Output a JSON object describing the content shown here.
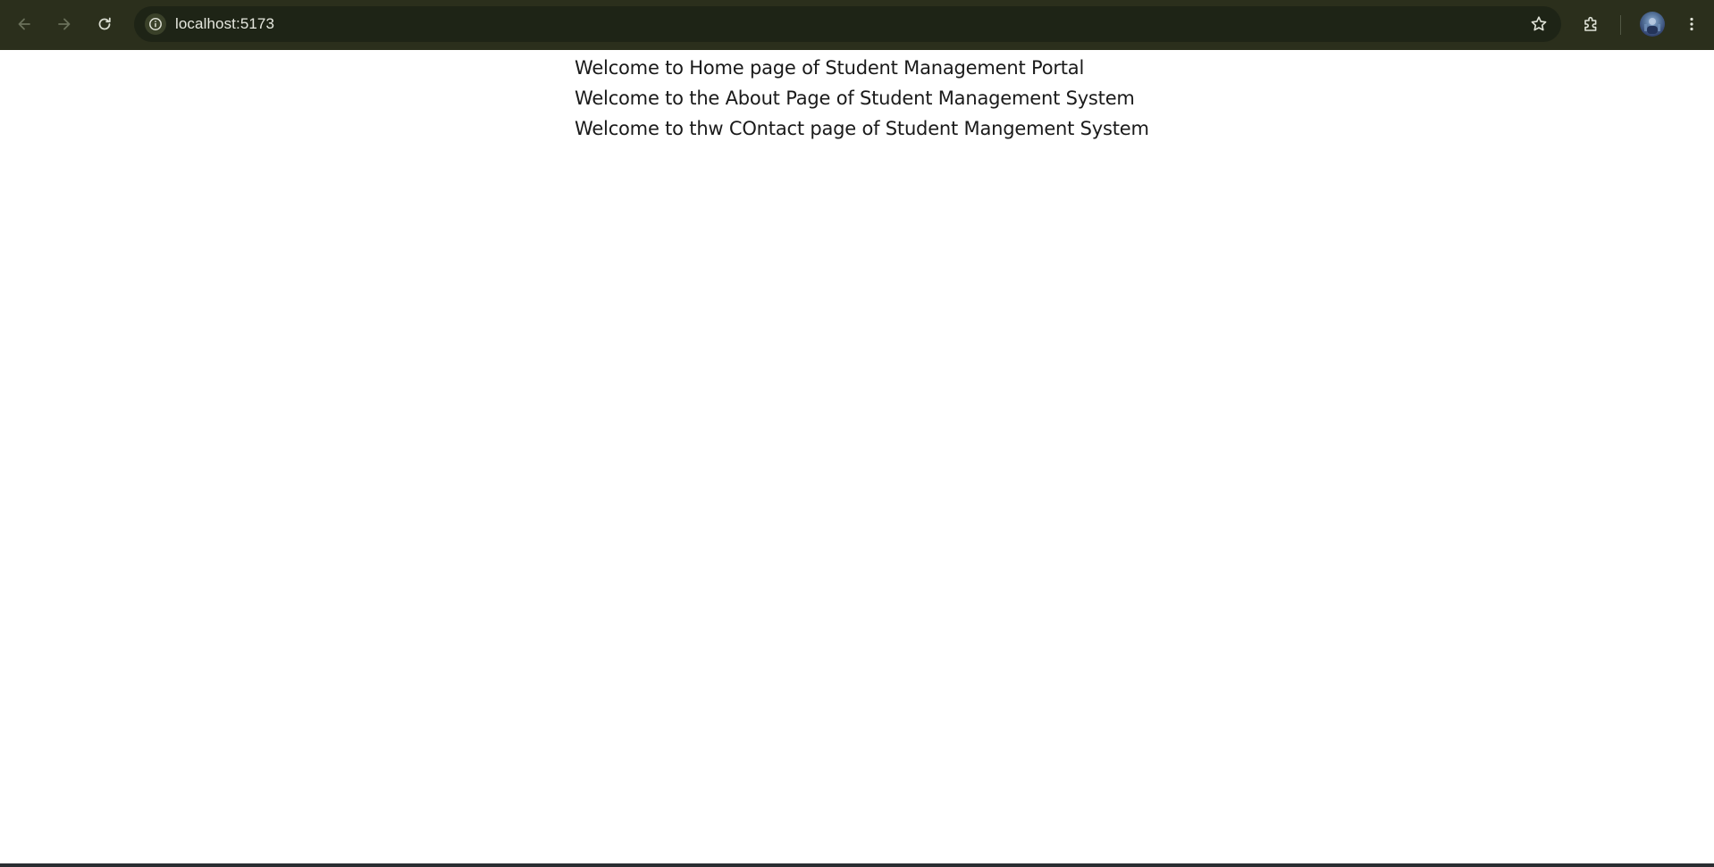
{
  "browser": {
    "url": "localhost:5173",
    "icons": {
      "back": "arrow-left-icon",
      "forward": "arrow-right-icon",
      "reload": "reload-icon",
      "site_info": "info-icon",
      "bookmark": "star-icon",
      "extensions": "puzzle-icon",
      "menu": "kebab-menu-icon"
    },
    "colors": {
      "toolbar": "#2b2f1c",
      "omnibox": "#1e2416"
    }
  },
  "page": {
    "lines": [
      "Welcome to Home page of Student Management Portal",
      "Welcome to the About Page of Student Management System",
      "Welcome to thw COntact page of Student Mangement System"
    ]
  }
}
